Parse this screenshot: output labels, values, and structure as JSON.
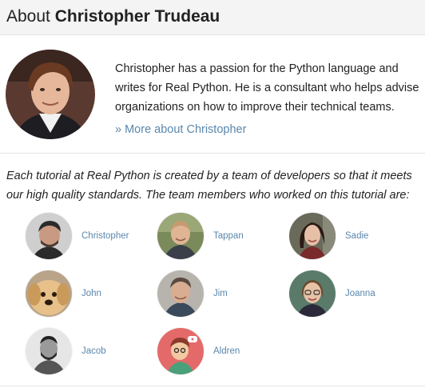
{
  "header": {
    "prefix": "About",
    "name": "Christopher Trudeau"
  },
  "bio": {
    "text": "Christopher has a passion for the Python language and writes for Real Python. He is a consultant who helps advise organizations on how to improve their technical teams.",
    "more_link": "» More about Christopher"
  },
  "team": {
    "intro": "Each tutorial at Real Python is created by a team of developers so that it meets our high quality standards. The team members who worked on this tutorial are:",
    "members": [
      {
        "name": "Christopher"
      },
      {
        "name": "Tappan"
      },
      {
        "name": "Sadie"
      },
      {
        "name": "John"
      },
      {
        "name": "Jim"
      },
      {
        "name": "Joanna"
      },
      {
        "name": "Jacob"
      },
      {
        "name": "Aldren"
      }
    ]
  },
  "colors": {
    "link": "#5a87ad",
    "header_bg": "#f4f4f4",
    "divider": "#e3e3e3"
  },
  "icons": [
    "christopher-photo",
    "tappan-photo",
    "sadie-photo",
    "john-dog-photo",
    "jim-photo",
    "joanna-photo",
    "jacob-photo",
    "aldren-cartoon-avatar"
  ]
}
